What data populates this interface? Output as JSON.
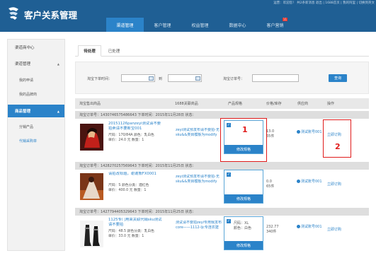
{
  "header": {
    "title": "客户关系管理",
    "info": "运营：欢迎您！ 共2条新消息 退出 | 1688首页 | 我的阿里 | 切换到英文"
  },
  "nav": [
    {
      "label": "渠道管理",
      "active": true
    },
    {
      "label": "客户管理",
      "active": false
    },
    {
      "label": "权益管理",
      "active": false
    },
    {
      "label": "数据中心",
      "active": false
    },
    {
      "label": "客户营销",
      "active": false,
      "badge": "11"
    }
  ],
  "sidebar": {
    "center": "渠道商中心",
    "channel_section": "渠道管理",
    "channel_items": [
      "我的申请",
      "我的品牌商"
    ],
    "product_section": "商品管理",
    "product_items": [
      "分销产品",
      "代销采购单"
    ]
  },
  "tabs": [
    "待处理",
    "已处理"
  ],
  "filter": {
    "time_label": "淘宝下单时间：",
    "to_label": "到",
    "order_label": "淘宝订单号：",
    "query_button": "查询"
  },
  "table": {
    "headers": [
      "淘宝售出商品",
      "1688关联商品",
      "产品规格",
      "价格/库存",
      "供应商",
      "操作"
    ]
  },
  "orders": [
    {
      "header": "淘宝订单号：1430746575486643 下单时间：2015年11月28日 状态：",
      "title": "20151126panzeyi测试请不要拍卖请不要新宝001",
      "size": "尺码：170/84A 颜色：乳白色",
      "unit_price": "单价：24.0 元 数量：1",
      "product": "zeyi测试预发布请不要拍-无sku&&类目模板为modify",
      "spec_check": "✓",
      "spec": "",
      "match": "修改规格",
      "price": "13.0",
      "stock": "65件",
      "supplier": "测试账号001",
      "action": "立即订购"
    },
    {
      "header": "淘宝订单号：1428270257569643 下单时间：2015年11月25日 状态：",
      "title": "请拍改标题，谢谢熊FX0001",
      "size": "尺码：S 颜色分类：酒红色",
      "unit_price": "单价：400.0 元 数量：1",
      "product": "zeyi测试预发布请不要拍-无sku&&类目模板为modify",
      "spec_check": "✓",
      "spec": "",
      "match": "修改规格",
      "price": "0.0",
      "stock": "65件",
      "supplier": "测试账号001",
      "action": "立即订购"
    },
    {
      "header": "淘宝订单号：1427794405329643 下单时间：2015年11月25日 状态：",
      "title": "1125专门用来关联代销sku测试请不要拍",
      "size": "尺码：48.5 颜色分类：乳白色",
      "unit_price": "单价：33.0 元 数量：1",
      "product": "测试请不要拍zeyi专用我发布core——1112-ljc专连农建",
      "spec_check": "✓",
      "spec": "尺码：XL\n颜色：白色",
      "match": "修改规格",
      "price": "232.77",
      "stock": "340件",
      "supplier": "测试账号001",
      "action": "立即订购"
    }
  ],
  "annotations": [
    "1",
    "2"
  ],
  "colors": {
    "header_bg": "#1f5f94",
    "accent": "#2b83c9",
    "highlight": "#e01b1b"
  }
}
